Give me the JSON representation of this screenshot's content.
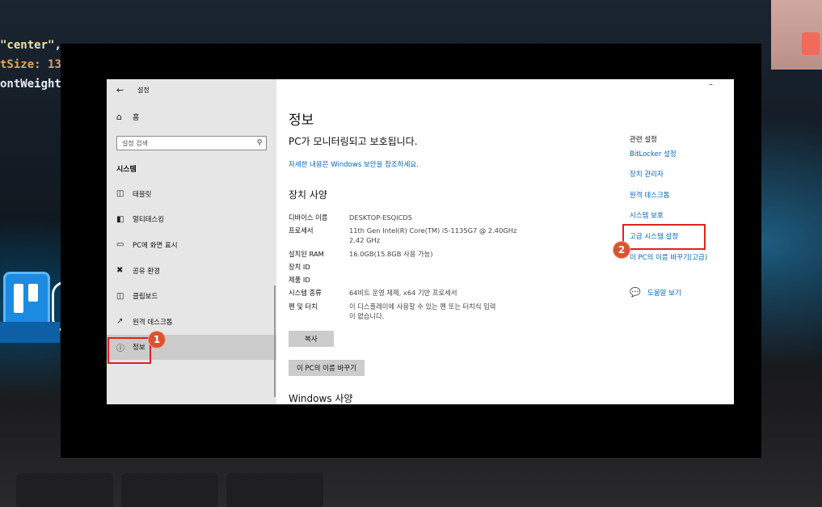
{
  "background": {
    "code_lines": [
      {
        "quoted": "\"center\"",
        "rest": ", "
      },
      {
        "quoted": "tSize: ",
        "rest": "13}}"
      },
      {
        "quoted": "ontWeight:",
        "rest": ""
      }
    ]
  },
  "window": {
    "title": "설정",
    "minimize_glyph": "–"
  },
  "sidebar": {
    "home_label": "홈",
    "search_placeholder": "설정 검색",
    "section_title": "시스템",
    "items": [
      {
        "label": "태블릿",
        "icon": "tablet-icon"
      },
      {
        "label": "멀티태스킹",
        "icon": "multitasking-icon"
      },
      {
        "label": "PC에 화면 표시",
        "icon": "project-icon"
      },
      {
        "label": "공유 환경",
        "icon": "shared-experience-icon"
      },
      {
        "label": "클립보드",
        "icon": "clipboard-icon"
      },
      {
        "label": "원격 데스크톱",
        "icon": "remote-desktop-icon"
      },
      {
        "label": "정보",
        "icon": "info-icon",
        "active": true
      }
    ]
  },
  "main": {
    "page_title": "정보",
    "protect_heading": "PC가 모니터링되고 보호됩니다.",
    "security_link": "자세한 내용은 Windows 보안을 참조하세요.",
    "spec_heading": "장치 사양",
    "specs": [
      {
        "label": "디바이스 이름",
        "value_lines": [
          "DESKTOP-ESQICD5"
        ]
      },
      {
        "label": "프로세서",
        "value_lines": [
          "11th Gen Intel(R) Core(TM) i5-1135G7 @ 2.40GHz",
          "2.42 GHz"
        ]
      },
      {
        "label": "설치된 RAM",
        "value_lines": [
          "16.0GB(15.8GB 사용 가능)"
        ]
      },
      {
        "label": "장치 ID",
        "value_lines": [
          ""
        ]
      },
      {
        "label": "제품 ID",
        "value_lines": [
          ""
        ]
      },
      {
        "label": "시스템 종류",
        "value_lines": [
          "64비트 운영 체제, x64 기반 프로세서"
        ]
      },
      {
        "label": "펜 및 터치",
        "value_lines": [
          "이 디스플레이에 사용할 수 있는 펜 또는 터치식 입력",
          "이 없습니다."
        ]
      }
    ],
    "copy_button": "복사",
    "rename_button": "이 PC의 이름 바꾸기",
    "windows_spec_heading": "Windows 사양"
  },
  "related": {
    "heading": "관련 설정",
    "links": [
      "BitLocker 설정",
      "장치 관리자",
      "원격 데스크톱",
      "시스템 보호",
      "고급 시스템 설정",
      "이 PC의 이름 바꾸기(고급)"
    ],
    "help_label": "도움말 보기"
  },
  "annotations": {
    "badge_1": "1",
    "badge_2": "2"
  },
  "colors": {
    "link": "#0067c0",
    "highlight_box": "#e02020",
    "badge": "#d8542f"
  }
}
